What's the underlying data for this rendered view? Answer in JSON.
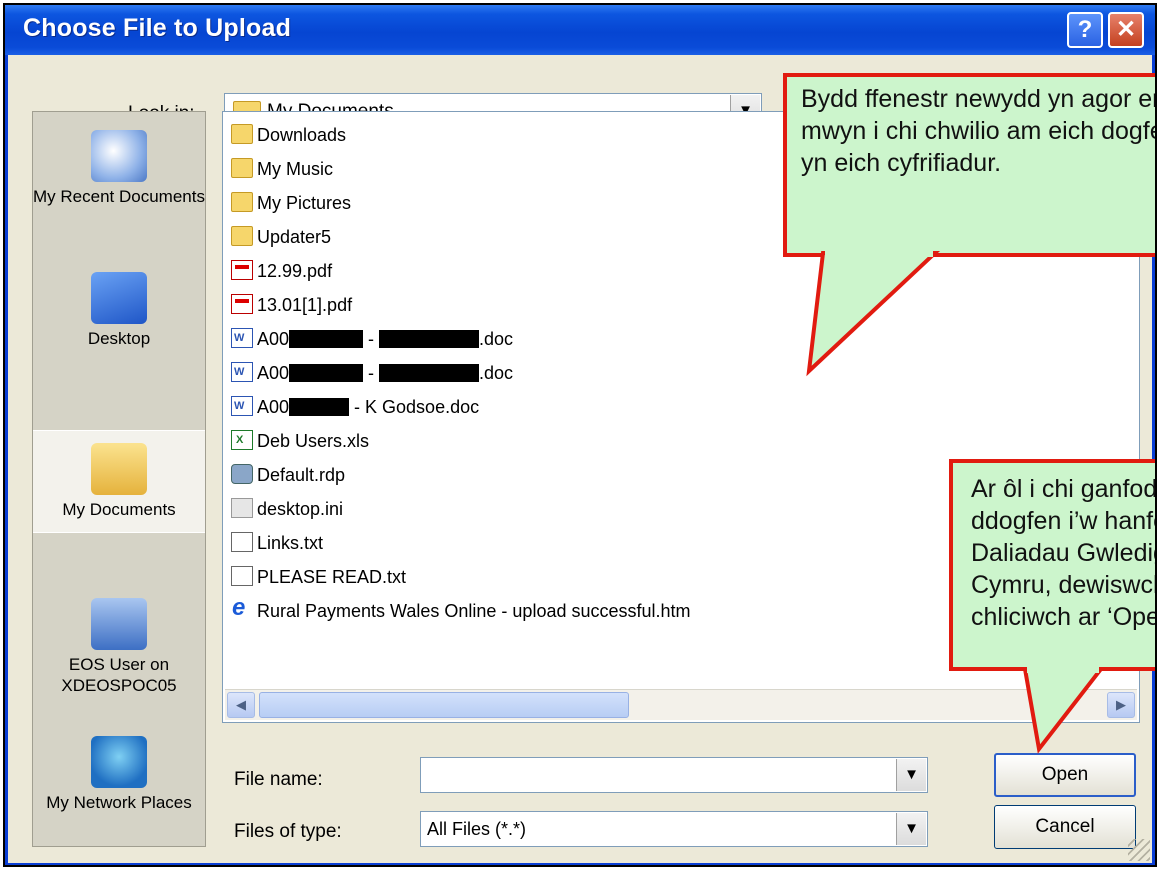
{
  "window": {
    "title": "Choose File to Upload",
    "help_label": "?",
    "close_label": "✕"
  },
  "look_in": {
    "label": "Look in:",
    "value": "My Documents"
  },
  "places": [
    {
      "label": "My Recent Documents",
      "icon": "recent-documents-icon"
    },
    {
      "label": "Desktop",
      "icon": "desktop-icon"
    },
    {
      "label": "My Documents",
      "icon": "my-documents-icon"
    },
    {
      "label": "EOS User on XDEOSPOC05",
      "icon": "computer-icon"
    },
    {
      "label": "My Network Places",
      "icon": "network-places-icon"
    }
  ],
  "files": [
    {
      "name": "Downloads",
      "icon": "folder"
    },
    {
      "name": "My Music",
      "icon": "folder"
    },
    {
      "name": "My Pictures",
      "icon": "folder"
    },
    {
      "name": "Updater5",
      "icon": "folder"
    },
    {
      "name": "12.99.pdf",
      "icon": "pdf"
    },
    {
      "name": "13.01[1].pdf",
      "icon": "pdf"
    },
    {
      "prefix": "A00",
      "mid": " - ",
      "suffix": ".doc",
      "icon": "doc"
    },
    {
      "prefix": "A00",
      "mid": " - ",
      "suffix": ".doc",
      "icon": "doc"
    },
    {
      "prefix": "A00",
      "mid": " - K Godsoe.doc",
      "suffix": "",
      "icon": "doc"
    },
    {
      "name": "Deb Users.xls",
      "icon": "xls"
    },
    {
      "name": "Default.rdp",
      "icon": "rdp"
    },
    {
      "name": "desktop.ini",
      "icon": "ini"
    },
    {
      "name": "Links.txt",
      "icon": "txt"
    },
    {
      "name": "PLEASE READ.txt",
      "icon": "txt"
    },
    {
      "name": "Rural Payments Wales Online - upload successful.htm",
      "icon": "htm"
    }
  ],
  "file_name": {
    "label": "File name:",
    "value": ""
  },
  "file_type": {
    "label": "Files of type:",
    "value": "All Files (*.*)"
  },
  "buttons": {
    "open": "Open",
    "cancel": "Cancel"
  },
  "callouts": {
    "top": "Bydd ffenestr newydd yn agor er mwyn i chi chwilio am eich dogfen yn eich cyfrifiadur.",
    "bottom": "Ar ôl i chi ganfod y ddogfen i’w hanfon i Daliadau Gwledig Cymru, dewiswch a chliciwch ar ‘Open’"
  },
  "colors": {
    "callout_fill": "#ccf5cc",
    "callout_border": "#e11b10",
    "titlebar": "#0645d2"
  }
}
